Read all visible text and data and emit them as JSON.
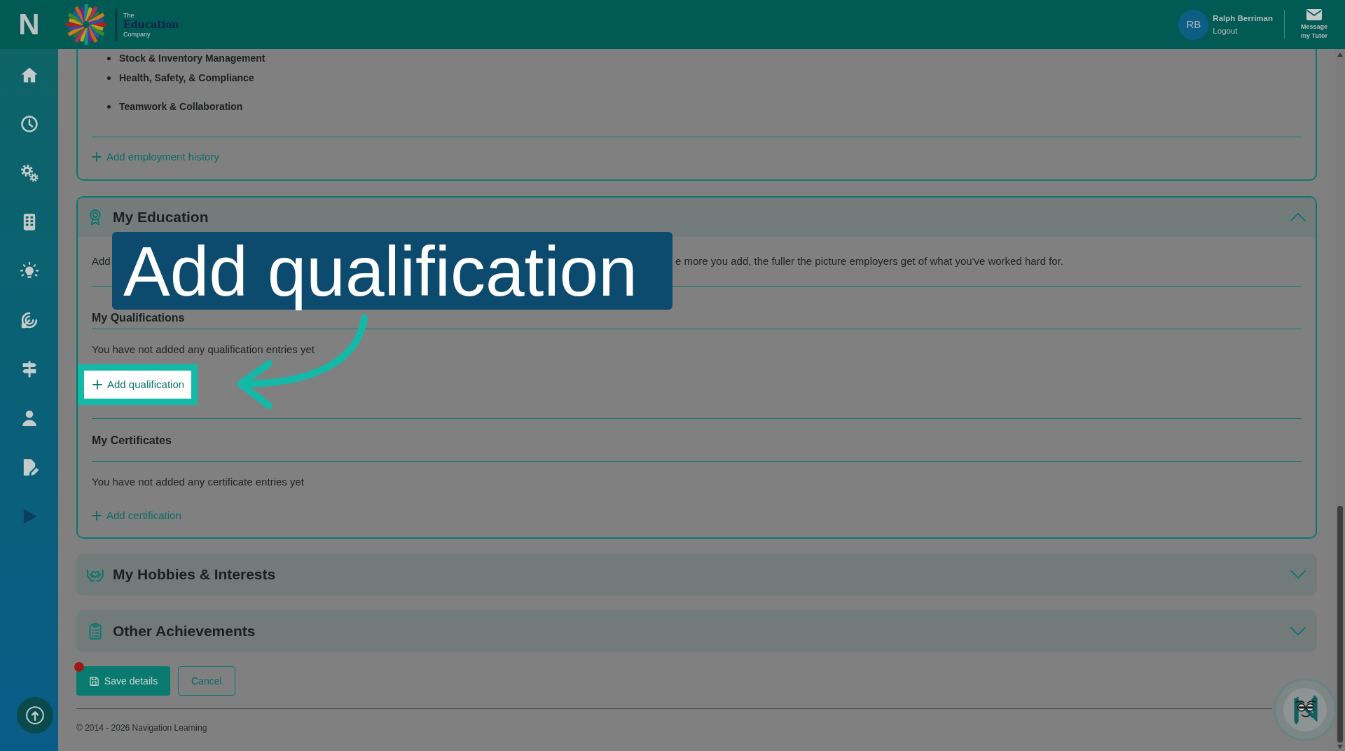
{
  "header": {
    "logo": {
      "line_1": "The",
      "line_2": "Education",
      "line_3": "Company"
    },
    "user": {
      "initials": "RB",
      "name": "Ralph Berriman",
      "logout": "Logout"
    },
    "message_button": "Message my Tutor"
  },
  "sidebar": {
    "logo": "N"
  },
  "employment": {
    "skills": [
      "Stock & Inventory Management",
      "Health, Safety, & Compliance",
      "Teamwork & Collaboration"
    ],
    "add_link": "Add employment history"
  },
  "sections": [
    {
      "title": "My Education",
      "expanded": true,
      "description": [
        "Add",
        "e more you add, the fuller the picture employers get of what you've worked hard for."
      ],
      "groups": [
        {
          "heading": "My Qualifications",
          "empty_text": "You have not added any qualification entries yet",
          "add_link": "Add qualification",
          "highlighted": true
        },
        {
          "heading": "My Certificates",
          "empty_text": "You have not added any certificate entries yet",
          "add_link": "Add certification",
          "highlighted": false
        }
      ]
    },
    {
      "title": "My Hobbies & Interests",
      "expanded": false
    },
    {
      "title": "Other Achievements",
      "expanded": false
    }
  ],
  "actions": {
    "save": "Save details",
    "save_alert_dot": true,
    "cancel": "Cancel"
  },
  "footer": {
    "copyright": "© 2014 - 2026 Navigation Learning"
  },
  "tutorial": {
    "callout": "Add qualification"
  }
}
